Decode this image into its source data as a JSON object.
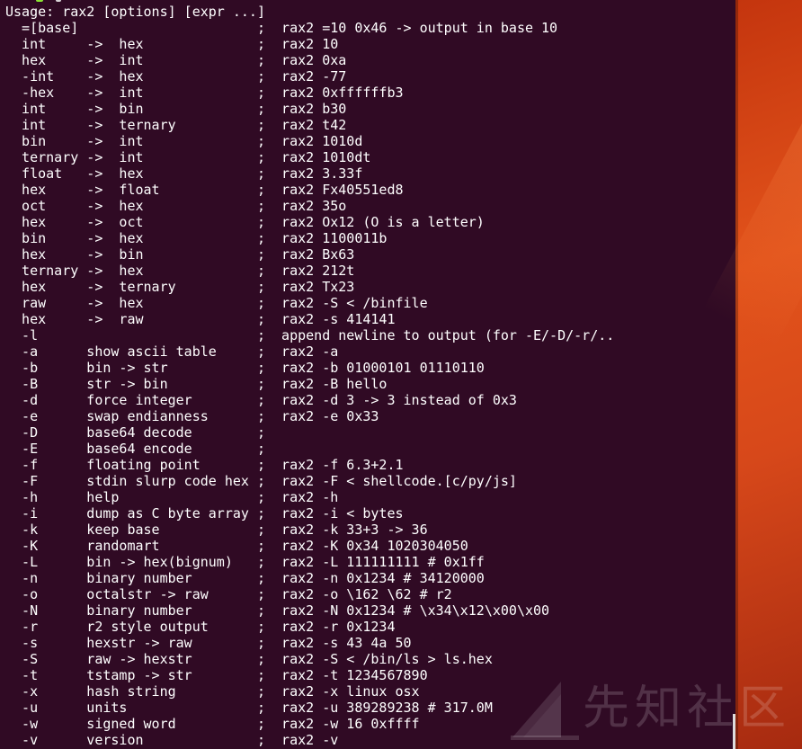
{
  "terminal": {
    "lines": [
      "Usage: rax2 [options] [expr ...]",
      "  =[base]                      ;  rax2 =10 0x46 -> output in base 10",
      "  int     ->  hex              ;  rax2 10",
      "  hex     ->  int              ;  rax2 0xa",
      "  -int    ->  hex              ;  rax2 -77",
      "  -hex    ->  int              ;  rax2 0xffffffb3",
      "  int     ->  bin              ;  rax2 b30",
      "  int     ->  ternary          ;  rax2 t42",
      "  bin     ->  int              ;  rax2 1010d",
      "  ternary ->  int              ;  rax2 1010dt",
      "  float   ->  hex              ;  rax2 3.33f",
      "  hex     ->  float            ;  rax2 Fx40551ed8",
      "  oct     ->  hex              ;  rax2 35o",
      "  hex     ->  oct              ;  rax2 Ox12 (O is a letter)",
      "  bin     ->  hex              ;  rax2 1100011b",
      "  hex     ->  bin              ;  rax2 Bx63",
      "  ternary ->  hex              ;  rax2 212t",
      "  hex     ->  ternary          ;  rax2 Tx23",
      "  raw     ->  hex              ;  rax2 -S < /binfile",
      "  hex     ->  raw              ;  rax2 -s 414141",
      "  -l                           ;  append newline to output (for -E/-D/-r/..",
      "  -a      show ascii table     ;  rax2 -a",
      "  -b      bin -> str           ;  rax2 -b 01000101 01110110",
      "  -B      str -> bin           ;  rax2 -B hello",
      "  -d      force integer        ;  rax2 -d 3 -> 3 instead of 0x3",
      "  -e      swap endianness      ;  rax2 -e 0x33",
      "  -D      base64 decode        ;",
      "  -E      base64 encode        ;",
      "  -f      floating point       ;  rax2 -f 6.3+2.1",
      "  -F      stdin slurp code hex ;  rax2 -F < shellcode.[c/py/js]",
      "  -h      help                 ;  rax2 -h",
      "  -i      dump as C byte array ;  rax2 -i < bytes",
      "  -k      keep base            ;  rax2 -k 33+3 -> 36",
      "  -K      randomart            ;  rax2 -K 0x34 1020304050",
      "  -L      bin -> hex(bignum)   ;  rax2 -L 111111111 # 0x1ff",
      "  -n      binary number        ;  rax2 -n 0x1234 # 34120000",
      "  -o      octalstr -> raw      ;  rax2 -o \\162 \\62 # r2",
      "  -N      binary number        ;  rax2 -N 0x1234 # \\x34\\x12\\x00\\x00",
      "  -r      r2 style output      ;  rax2 -r 0x1234",
      "  -s      hexstr -> raw        ;  rax2 -s 43 4a 50",
      "  -S      raw -> hexstr        ;  rax2 -S < /bin/ls > ls.hex",
      "  -t      tstamp -> str        ;  rax2 -t 1234567890",
      "  -x      hash string          ;  rax2 -x linux osx",
      "  -u      units                ;  rax2 -u 389289238 # 317.0M",
      "  -w      signed word          ;  rax2 -w 16 0xffff",
      "  -v      version              ;  rax2 -v"
    ]
  },
  "watermark": {
    "text": "先知社区",
    "icon": "xianzhi-logo-icon"
  },
  "colors": {
    "terminal_bg": "#300a24",
    "terminal_fg": "#ffffff",
    "wallpaper": "#e2531b"
  }
}
